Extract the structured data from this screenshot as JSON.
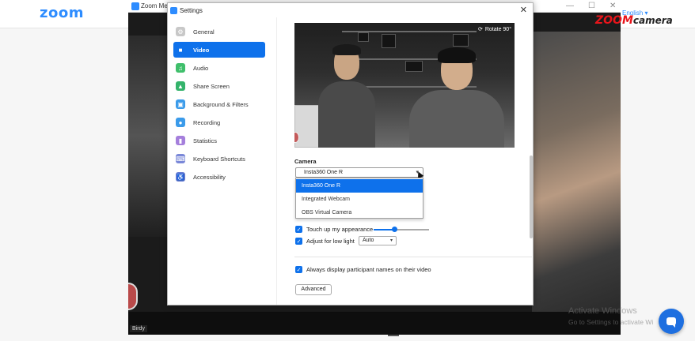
{
  "browser": {
    "logo": "zoom"
  },
  "meeting_window": {
    "title": "Zoom Mee",
    "participant_name": "Birdy",
    "controls": [
      "—",
      "☐",
      "✕"
    ]
  },
  "branding": {
    "language": "English",
    "logo_red": "ZOOM",
    "logo_dark": "camera"
  },
  "watermark": {
    "title": "Activate Windows",
    "subtitle": "Go to Settings to activate Wi"
  },
  "settings": {
    "title": "Settings",
    "close": "✕",
    "sidebar": [
      {
        "label": "General",
        "icon": "gear-icon",
        "color": "#c8c8c8",
        "glyph": "⚙"
      },
      {
        "label": "Video",
        "icon": "video-camera-icon",
        "color": "#ffffff",
        "glyph": "■",
        "active": true
      },
      {
        "label": "Audio",
        "icon": "headphones-icon",
        "color": "#3fbf6b",
        "glyph": "♫"
      },
      {
        "label": "Share Screen",
        "icon": "share-screen-icon",
        "color": "#34b36b",
        "glyph": "▲"
      },
      {
        "label": "Background & Filters",
        "icon": "background-icon",
        "color": "#3b9bea",
        "glyph": "▣"
      },
      {
        "label": "Recording",
        "icon": "recording-icon",
        "color": "#3b9bea",
        "glyph": "●"
      },
      {
        "label": "Statistics",
        "icon": "statistics-icon",
        "color": "#a57fdc",
        "glyph": "▮"
      },
      {
        "label": "Keyboard Shortcuts",
        "icon": "keyboard-icon",
        "color": "#7a88d8",
        "glyph": "⌨"
      },
      {
        "label": "Accessibility",
        "icon": "accessibility-icon",
        "color": "#6a7ed3",
        "glyph": "♿"
      }
    ],
    "video": {
      "rotate_label": "Rotate 90°",
      "camera_label": "Camera",
      "camera_selected": "Insta360 One R",
      "camera_options": [
        "Insta360 One R",
        "Integrated Webcam",
        "OBS Virtual Camera"
      ],
      "touch_up_label": "Touch up my appearance",
      "touch_up_level": 0.37,
      "low_light_label": "Adjust for low light",
      "low_light_value": "Auto",
      "display_names_label": "Always display participant names on their video",
      "advanced_label": "Advanced"
    }
  }
}
